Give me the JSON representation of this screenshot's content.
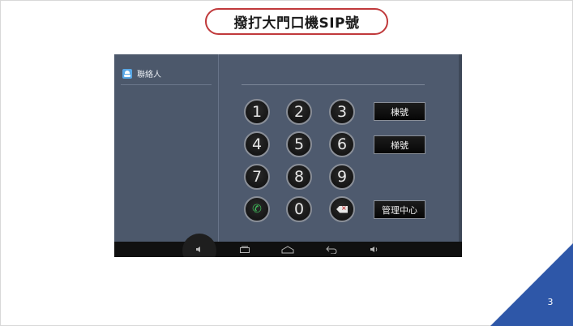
{
  "slide": {
    "title": "撥打大門口機SIP號",
    "page_number": "3",
    "accent_color": "#c0393b",
    "corner_color": "#2e57a8"
  },
  "app": {
    "sidebar": {
      "items": [
        {
          "label": "聯絡人",
          "icon": "contacts-icon"
        }
      ]
    },
    "keypad": {
      "keys": [
        "1",
        "2",
        "3",
        "4",
        "5",
        "6",
        "7",
        "8",
        "9",
        "call",
        "0",
        "delete"
      ],
      "call_icon": "phone-icon",
      "delete_icon": "backspace-icon"
    },
    "side_buttons": {
      "building": "棟號",
      "stairs": "梯號",
      "management": "管理中心"
    },
    "navbar": {
      "icons": [
        "volume-down-icon",
        "recent-apps-icon",
        "home-icon",
        "back-icon",
        "volume-up-icon"
      ]
    }
  }
}
